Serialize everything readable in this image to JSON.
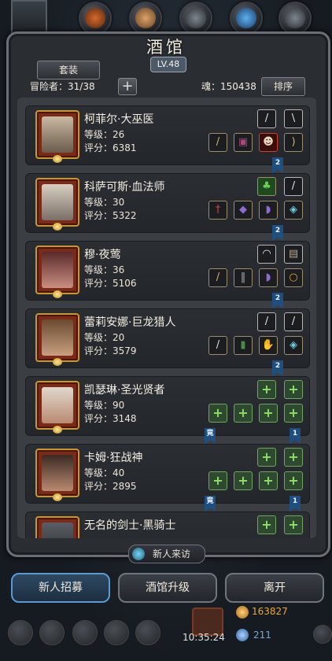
{
  "header": {
    "title": "酒馆",
    "level": "LV.48",
    "set_button": "套装",
    "adventurers_label": "冒险者：",
    "adventurers_count": "31/38",
    "soul_label": "魂：",
    "soul_value": "150438",
    "sort_button": "排序"
  },
  "heroes": [
    {
      "name": "柯菲尔·大巫医",
      "level_text": "等级：26",
      "score_text": "评分：6381"
    },
    {
      "name": "科萨可斯·血法师",
      "level_text": "等级：30",
      "score_text": "评分：5322"
    },
    {
      "name": "穆·夜莺",
      "level_text": "等级：36",
      "score_text": "评分：5106"
    },
    {
      "name": "蕾莉安娜·巨龙猎人",
      "level_text": "等级：20",
      "score_text": "评分：3579"
    },
    {
      "name": "凯瑟琳·圣光贤者",
      "level_text": "等级：90",
      "score_text": "评分：3148"
    },
    {
      "name": "卡姆·狂战神",
      "level_text": "等级：40",
      "score_text": "评分：2895"
    },
    {
      "name": "无名的剑士·黑骑士",
      "level_text": "",
      "score_text": ""
    }
  ],
  "ribbons": {
    "count_2": "2",
    "jing": "竟",
    "count_1": "1"
  },
  "bottom": {
    "new_visitor": "新人来访",
    "recruit": "新人招募",
    "upgrade": "酒馆升级",
    "leave": "离开",
    "gold": "163827",
    "gems": "211",
    "clock": "10:35:24"
  },
  "colors": {
    "portrait_border": "#c7962d",
    "ribbon": "#1e4f80",
    "empty_slot": "#2e4a2e",
    "active_button": "#2f4a63"
  }
}
